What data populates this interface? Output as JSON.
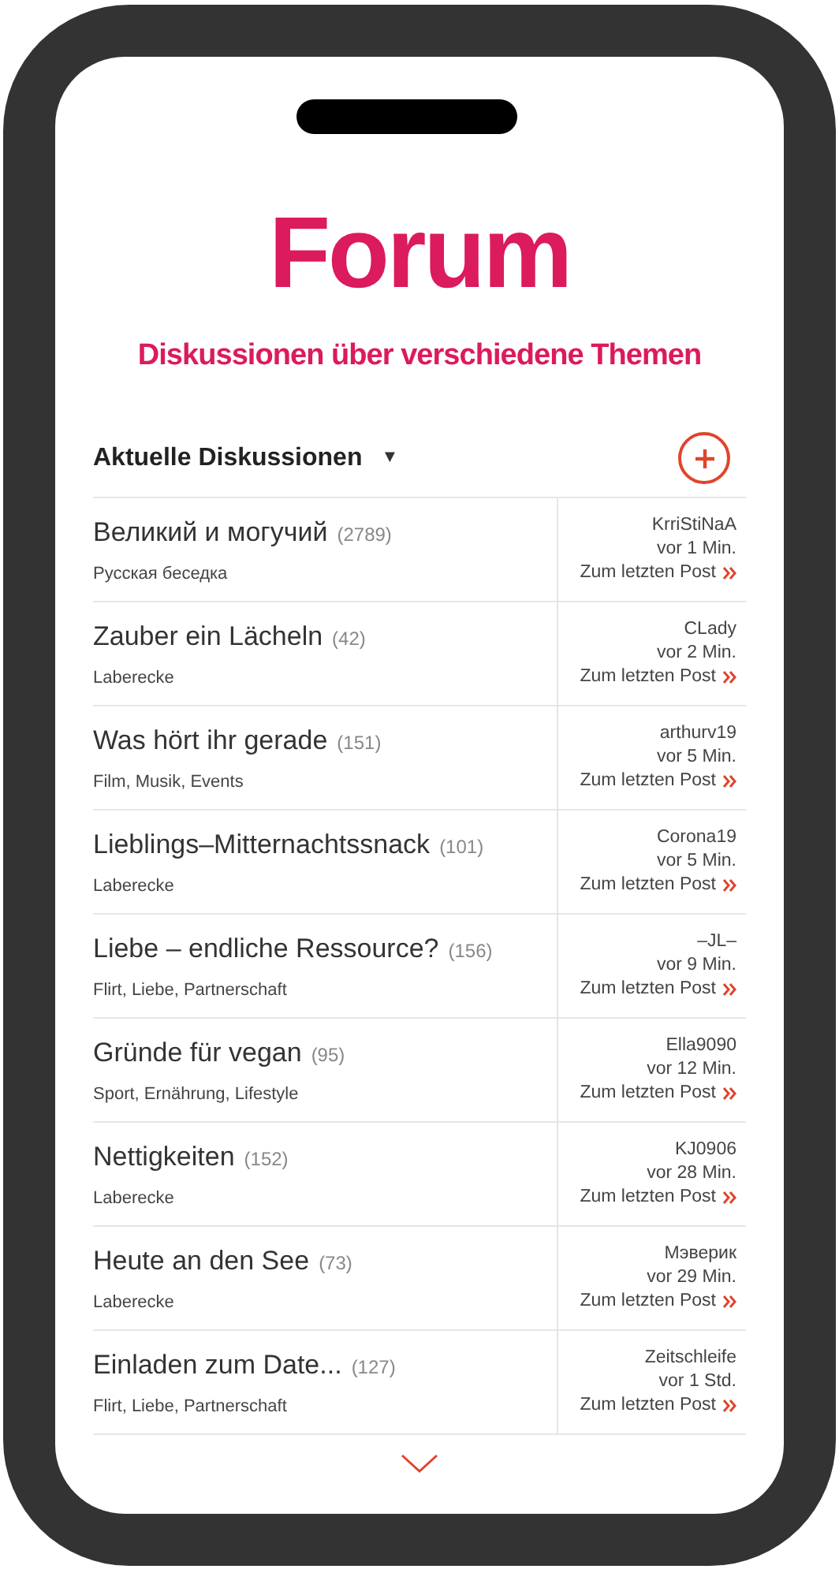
{
  "header": {
    "title": "Forum",
    "subtitle": "Diskussionen über verschiedene Themen"
  },
  "list_header": {
    "label": "Aktuelle Diskussionen",
    "dropdown": "▼"
  },
  "discussions": [
    {
      "title": "Великий и могучий",
      "count": "(2789)",
      "category": "Русская беседка",
      "user": "KrriStiNaA",
      "time": "vor 1 Min.",
      "link": "Zum letzten Post"
    },
    {
      "title": "Zauber ein Lächeln",
      "count": "(42)",
      "category": "Laberecke",
      "user": "CLady",
      "time": "vor 2 Min.",
      "link": "Zum letzten Post"
    },
    {
      "title": "Was hört ihr gerade",
      "count": "(151)",
      "category": "Film, Musik, Events",
      "user": "arthurv19",
      "time": "vor 5 Min.",
      "link": "Zum letzten Post"
    },
    {
      "title": "Lieblings–Mitternachtssnack",
      "count": "(101)",
      "category": "Laberecke",
      "user": "Corona19",
      "time": "vor 5 Min.",
      "link": "Zum letzten Post"
    },
    {
      "title": "Liebe – endliche Ressource?",
      "count": "(156)",
      "category": "Flirt, Liebe, Partnerschaft",
      "user": "–JL–",
      "time": "vor 9 Min.",
      "link": "Zum letzten Post"
    },
    {
      "title": "Gründe für vegan",
      "count": "(95)",
      "category": "Sport, Ernährung, Lifestyle",
      "user": "Ella9090",
      "time": "vor 12 Min.",
      "link": "Zum letzten Post"
    },
    {
      "title": "Nettigkeiten",
      "count": "(152)",
      "category": "Laberecke",
      "user": "KJ0906",
      "time": "vor 28 Min.",
      "link": "Zum letzten Post"
    },
    {
      "title": "Heute an den See",
      "count": "(73)",
      "category": "Laberecke",
      "user": "Мэверик",
      "time": "vor 29 Min.",
      "link": "Zum letzten Post"
    },
    {
      "title": "Einladen zum Date...",
      "count": "(127)",
      "category": "Flirt, Liebe, Partnerschaft",
      "user": "Zeitschleife",
      "time": "vor 1 Std.",
      "link": "Zum letzten Post"
    }
  ]
}
